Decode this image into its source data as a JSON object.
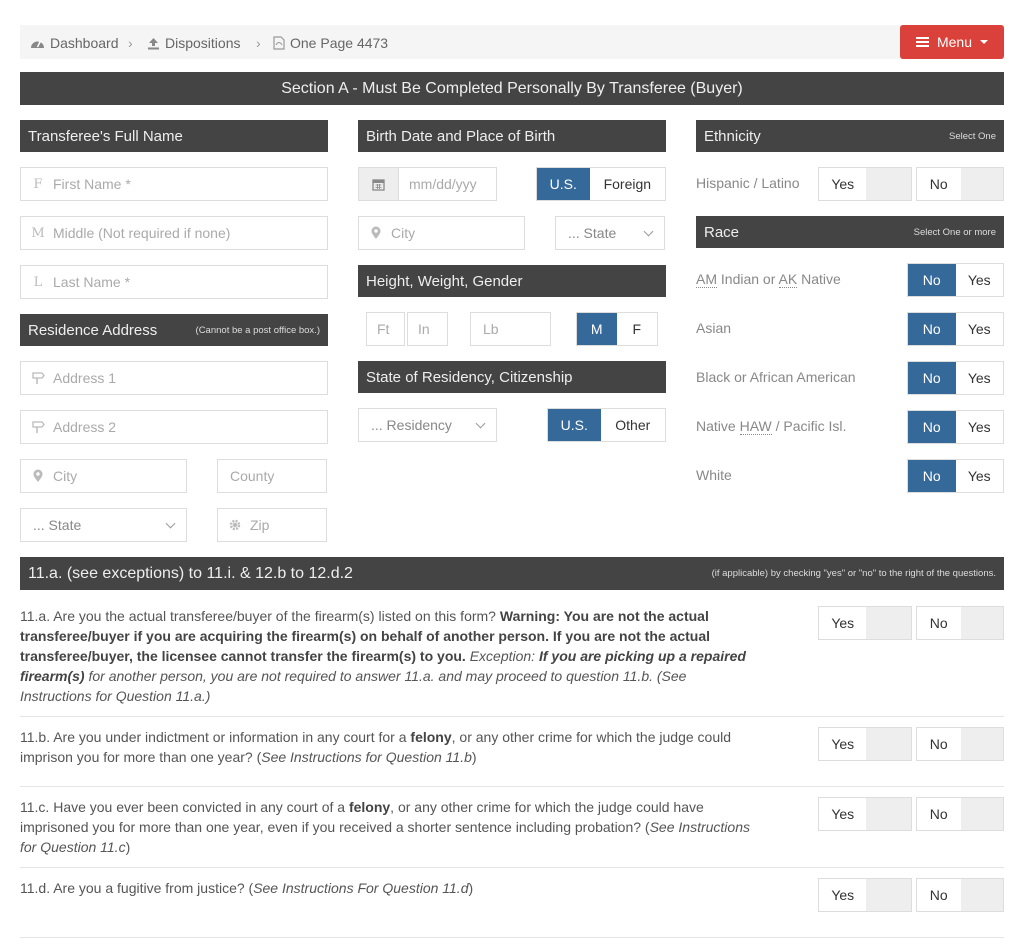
{
  "breadcrumb": {
    "dashboard": "Dashboard",
    "dispositions": "Dispositions",
    "page": "One Page 4473",
    "separator": "›"
  },
  "menu": {
    "label": "Menu"
  },
  "section_a": {
    "title": "Section A - Must Be Completed Personally By Transferee (Buyer)"
  },
  "name": {
    "header": "Transferee's Full Name",
    "first_icon": "F",
    "first_placeholder": "First Name *",
    "middle_icon": "M",
    "middle_placeholder": "Middle (Not required if none)",
    "last_icon": "L",
    "last_placeholder": "Last Name *"
  },
  "residence": {
    "header": "Residence Address",
    "note": "(Cannot be a post office box.)",
    "address1": "Address 1",
    "address2": "Address 2",
    "city": "City",
    "county": "County",
    "state": "... State",
    "zip": "Zip"
  },
  "birth": {
    "header": "Birth Date and Place of Birth",
    "date_placeholder": "mm/dd/yyy",
    "us": "U.S.",
    "foreign": "Foreign",
    "city": "City",
    "state": "... State"
  },
  "hwg": {
    "header": "Height, Weight, Gender",
    "ft": "Ft",
    "in": "In",
    "lb": "Lb",
    "m": "M",
    "f": "F"
  },
  "residency": {
    "header": "State of Residency, Citizenship",
    "select": "... Residency",
    "us": "U.S.",
    "other": "Other"
  },
  "ethnicity": {
    "header": "Ethnicity",
    "note": "Select One",
    "label": "Hispanic / Latino",
    "yes": "Yes",
    "no": "No"
  },
  "race": {
    "header": "Race",
    "note": "Select One or more",
    "no": "No",
    "yes": "Yes",
    "items": [
      {
        "pre": "",
        "abbr1": "AM",
        "mid": " Indian or ",
        "abbr2": "AK",
        "post": " Native"
      },
      {
        "pre": "Asian",
        "abbr1": "",
        "mid": "",
        "abbr2": "",
        "post": ""
      },
      {
        "pre": "Black or African American",
        "abbr1": "",
        "mid": "",
        "abbr2": "",
        "post": ""
      },
      {
        "pre": "Native ",
        "abbr1": "HAW",
        "mid": " / Pacific Isl.",
        "abbr2": "",
        "post": ""
      },
      {
        "pre": "White",
        "abbr1": "",
        "mid": "",
        "abbr2": "",
        "post": ""
      }
    ]
  },
  "questions_bar": {
    "title": "11.a. (see exceptions) to 11.i. & 12.b to 12.d.2",
    "note": "(if applicable) by checking \"yes\" or \"no\" to the right of the questions."
  },
  "questions": {
    "yes": "Yes",
    "no": "No",
    "q11a_1": "11.a. Are you the actual transferee/buyer of the firearm(s) listed on this form? ",
    "q11a_2": "Warning: You are not the actual transferee/buyer if you are acquiring the firearm(s) on behalf of another person. If you are not the actual transferee/buyer, the licensee cannot transfer the firearm(s) to you.",
    "q11a_3": " Exception: ",
    "q11a_4": "If you are picking up a repaired firearm(s)",
    "q11a_5": " for another person, you are not required to answer 11.a. and may proceed to question 11.b. (See Instructions for Question 11.a.)",
    "q11b_1": "11.b. Are you under indictment or information in any court for a ",
    "q11b_2": "felony",
    "q11b_3": ", or any other crime for which the judge could imprison you for more than one year? (",
    "q11b_4": "See Instructions for Question 11.b",
    "q11b_5": ")",
    "q11c_1": "11.c. Have you ever been convicted in any court of a ",
    "q11c_2": "felony",
    "q11c_3": ", or any other crime for which the judge could have imprisoned you for more than one year, even if you received a shorter sentence including probation? (",
    "q11c_4": "See Instructions for Question 11.c",
    "q11c_5": ")",
    "q11d_1": "11.d. Are you a fugitive from justice? (",
    "q11d_2": "See Instructions For Question 11.d",
    "q11d_3": ")"
  }
}
